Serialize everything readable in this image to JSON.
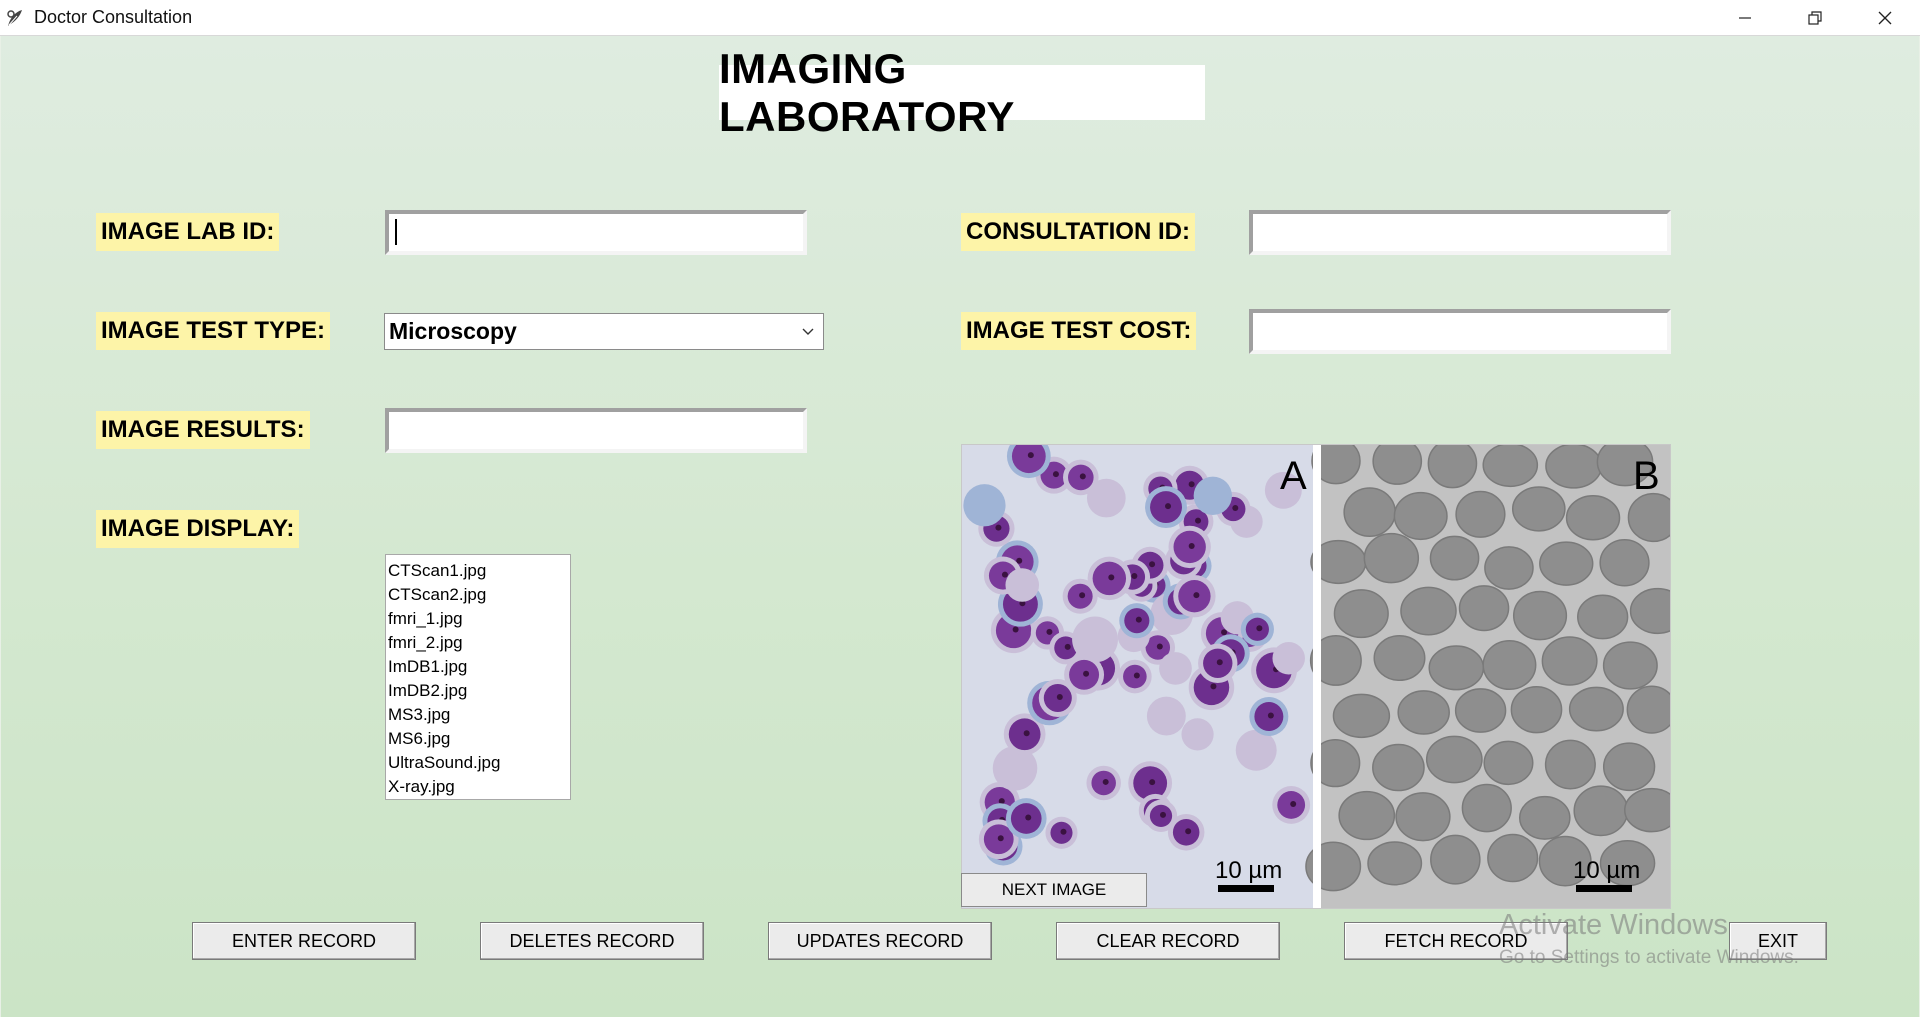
{
  "window": {
    "title": "Doctor Consultation",
    "icons": {
      "app": "feather-quill-icon",
      "minimize": "minimize-icon",
      "restore": "restore-icon",
      "close": "close-icon"
    }
  },
  "form": {
    "heading": "IMAGING LABORATORY",
    "labels": {
      "image_lab_id": "IMAGE LAB ID:",
      "image_test_type": "IMAGE TEST TYPE:",
      "image_results": "IMAGE RESULTS:",
      "image_display": "IMAGE DISPLAY:",
      "consultation_id": "CONSULTATION ID:",
      "image_test_cost": "IMAGE TEST COST:"
    },
    "fields": {
      "image_lab_id": "",
      "consultation_id": "",
      "image_test_cost": "",
      "image_results": ""
    },
    "test_type": {
      "selected": "Microscopy"
    }
  },
  "image_files": [
    "CTScan1.jpg",
    "CTScan2.jpg",
    "fmri_1.jpg",
    "fmri_2.jpg",
    "ImDB1.jpg",
    "ImDB2.jpg",
    "MS3.jpg",
    "MS6.jpg",
    "UltraSound.jpg",
    "X-ray.jpg"
  ],
  "image_display": {
    "panel_a_label": "A",
    "panel_b_label": "B",
    "scale_a": "10 µm",
    "scale_b": "10 µm",
    "next_button": "NEXT IMAGE"
  },
  "buttons": {
    "enter": "ENTER RECORD",
    "delete": "DELETES RECORD",
    "update": "UPDATES RECORD",
    "clear": "CLEAR RECORD",
    "fetch": "FETCH RECORD",
    "exit": "EXIT"
  },
  "watermark": {
    "title": "Activate Windows",
    "subtitle": "Go to Settings to activate Windows."
  },
  "colors": {
    "label_bg": "#fdf4a8",
    "background": "#d4e8d0",
    "cell_purple": "#7a3a9a",
    "rbc_gray": "#8e8e8e"
  }
}
